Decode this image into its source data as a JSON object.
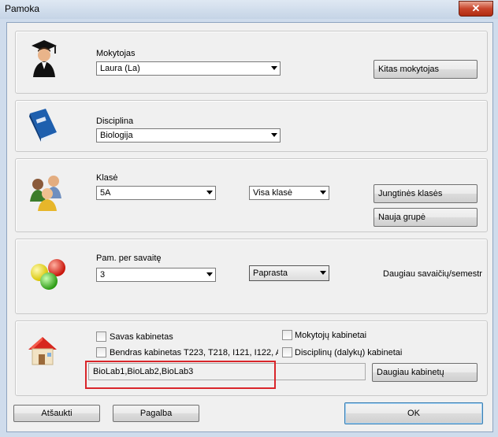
{
  "window": {
    "title": "Pamoka",
    "close_glyph": "✕"
  },
  "teacher": {
    "label": "Mokytojas",
    "value": "Laura (La)",
    "other_button": "Kitas mokytojas",
    "icon": "teacher-graduate-icon"
  },
  "subject": {
    "label": "Disciplina",
    "value": "Biologija",
    "icon": "blue-book-icon"
  },
  "class": {
    "label": "Klasė",
    "value": "5A",
    "group_value": "Visa klasė",
    "joint_button": "Jungtinės klasės",
    "new_group_button": "Nauja grupė",
    "icon": "people-group-icon"
  },
  "lessons": {
    "label": "Pam. per savaitę",
    "value": "3",
    "type_value": "Paprasta",
    "more_text": "Daugiau savaičių/semestr",
    "icon": "colored-balls-icon"
  },
  "rooms": {
    "own_room": "Savas kabinetas",
    "shared_rooms": "Bendras kabinetas T223, T218, I121, I122, A",
    "teacher_rooms": "Mokytojų kabinetai",
    "subject_rooms": "Disciplinų (dalykų) kabinetai",
    "selected_rooms": "BioLab1,BioLab2,BioLab3",
    "more_button": "Daugiau kabinetų",
    "icon": "house-icon"
  },
  "footer": {
    "cancel": "Atšaukti",
    "help": "Pagalba",
    "ok": "OK"
  },
  "colors": {
    "highlight": "#d9252a"
  }
}
